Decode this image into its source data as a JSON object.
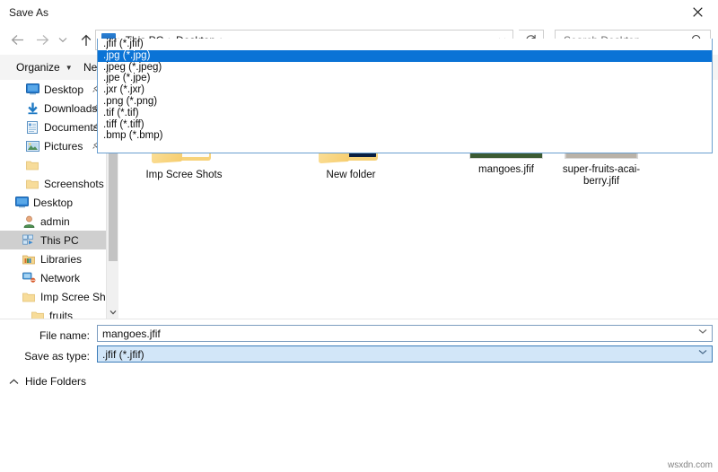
{
  "window": {
    "title": "Save As",
    "close_label": "✕"
  },
  "nav": {
    "back_icon": "arrow-left-icon",
    "forward_icon": "arrow-right-icon",
    "recent_icon": "chevron-down-icon",
    "up_icon": "arrow-up-icon",
    "refresh_icon": "refresh-icon",
    "address_chevron": "chevron-down-icon"
  },
  "address": {
    "drive_icon": "this-pc-icon",
    "crumbs": [
      "This PC",
      "Desktop"
    ],
    "separator": "›"
  },
  "search": {
    "placeholder": "Search Desktop",
    "value": "",
    "icon": "search-icon"
  },
  "commandbar": {
    "organize": "Organize",
    "organize_caret": "▼",
    "new_folder": "New folder",
    "view_icon": "view-layout-icon",
    "view_caret": "▼",
    "help_label": "?"
  },
  "sidebar": {
    "items": [
      {
        "label": "Desktop",
        "icon": "desktop-icon",
        "pinned": true,
        "selected": false
      },
      {
        "label": "Downloads",
        "icon": "download-icon",
        "pinned": true,
        "selected": false
      },
      {
        "label": "Documents",
        "icon": "documents-icon",
        "pinned": true,
        "selected": false
      },
      {
        "label": "Pictures",
        "icon": "pictures-icon",
        "pinned": true,
        "selected": false
      },
      {
        "label": "",
        "icon": "folder-icon",
        "pinned": false,
        "selected": false
      },
      {
        "label": "Screenshots",
        "icon": "folder-icon",
        "pinned": false,
        "selected": false
      },
      {
        "label": "Desktop",
        "icon": "desktop-icon",
        "pinned": false,
        "selected": false
      },
      {
        "label": "admin",
        "icon": "user-icon",
        "pinned": false,
        "selected": false
      },
      {
        "label": "This PC",
        "icon": "this-pc-icon",
        "pinned": false,
        "selected": true
      },
      {
        "label": "Libraries",
        "icon": "libraries-icon",
        "pinned": false,
        "selected": false
      },
      {
        "label": "Network",
        "icon": "network-icon",
        "pinned": false,
        "selected": false
      },
      {
        "label": "Imp Scree Shots",
        "icon": "folder-icon",
        "pinned": false,
        "selected": false
      },
      {
        "label": "fruits",
        "icon": "folder-icon",
        "pinned": false,
        "selected": false
      }
    ],
    "scroll_up_icon": "chevron-up-icon",
    "scroll_down_icon": "chevron-down-icon"
  },
  "files": [
    {
      "name": "Imp Scree Shots",
      "kind": "folder-chrome"
    },
    {
      "name": "New folder",
      "kind": "folder-wallpaper"
    },
    {
      "name": "mangoes.jfif",
      "kind": "image-mangoes"
    },
    {
      "name": "super-fruits-acai-berry.jfif",
      "kind": "image-berries"
    }
  ],
  "form": {
    "file_name_label": "File name:",
    "file_name_value": "mangoes.jfif",
    "save_type_label": "Save as type:",
    "save_type_value": ".jfif (*.jfif)",
    "combo_arrow": "chevron-down-icon",
    "hide_folders_label": "Hide Folders",
    "hide_folders_caret": "^"
  },
  "dropdown": {
    "open": true,
    "selected_index": 1,
    "options": [
      ".jfif (*.jfif)",
      ".jpg (*.jpg)",
      ".jpeg (*.jpeg)",
      ".jpe (*.jpe)",
      ".jxr (*.jxr)",
      ".png (*.png)",
      ".tif (*.tif)",
      ".tiff (*.tiff)",
      ".bmp (*.bmp)"
    ]
  },
  "watermark": "wsxdn.com",
  "colors": {
    "accent_blue": "#0a73d6",
    "combo_highlight": "#d2e6f8",
    "selection_gray": "#cfcfcf",
    "toolbar_gray": "#f4f4f4"
  }
}
